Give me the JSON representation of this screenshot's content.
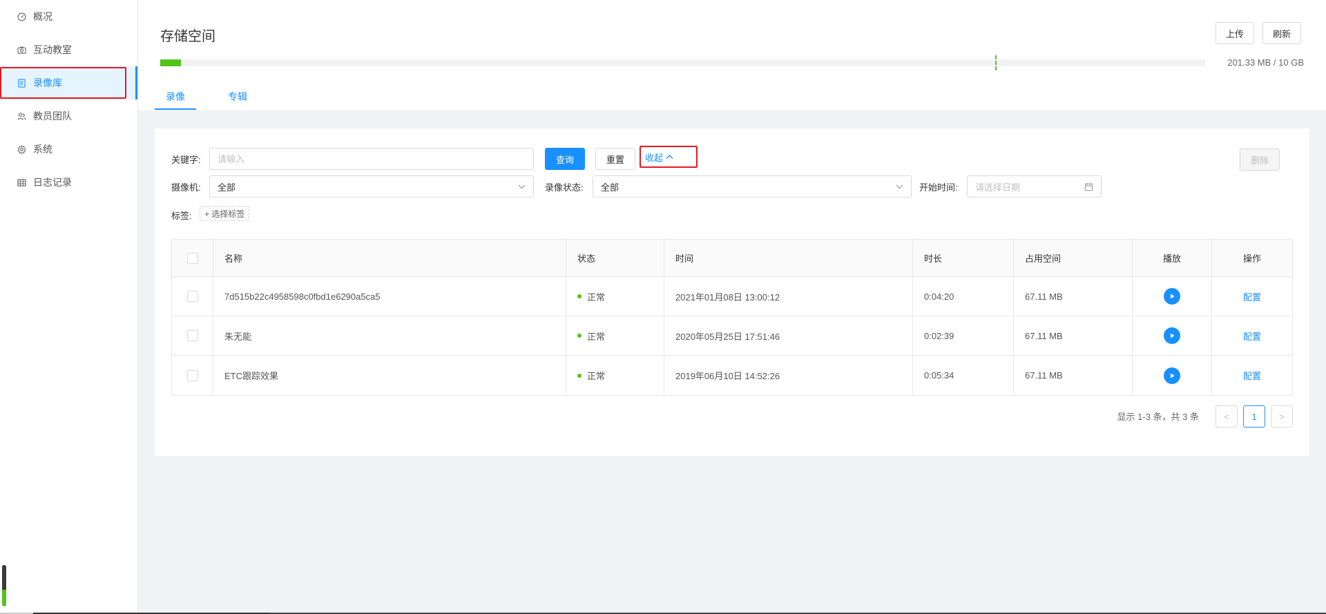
{
  "sidebar": {
    "items": [
      {
        "label": "概况",
        "icon": "dashboard-icon"
      },
      {
        "label": "互动教室",
        "icon": "camera-icon"
      },
      {
        "label": "录像库",
        "icon": "video-library-icon"
      },
      {
        "label": "教员团队",
        "icon": "team-icon"
      },
      {
        "label": "系统",
        "icon": "gear-icon"
      },
      {
        "label": "日志记录",
        "icon": "table-icon"
      }
    ],
    "active_index": 2
  },
  "header": {
    "title": "存储空间",
    "upload_label": "上传",
    "refresh_label": "刷新",
    "usage_text": "201.33 MB / 10 GB",
    "usage_fill_fraction": 0.0197,
    "tabs": [
      {
        "label": "录像"
      },
      {
        "label": "专辑"
      }
    ]
  },
  "filters": {
    "keyword_label": "关键字:",
    "keyword_placeholder": "请输入",
    "query_label": "查询",
    "reset_label": "重置",
    "collapse_label": "收起",
    "delete_label": "删除",
    "camera_label": "摄像机:",
    "camera_value": "全部",
    "status_label": "录像状态:",
    "status_value": "全部",
    "start_time_label": "开始时间:",
    "start_time_placeholder": "请选择日期",
    "tags_label": "标签:",
    "tags_add_label": "+ 选择标签"
  },
  "table": {
    "headers": {
      "name": "名称",
      "status": "状态",
      "time": "时间",
      "duration": "时长",
      "size": "占用空间",
      "play": "播放",
      "action": "操作"
    },
    "rows": [
      {
        "name": "7d515b22c4958598c0fbd1e6290a5ca5",
        "status": "正常",
        "time": "2021年01月08日 13:00:12",
        "duration": "0:04:20",
        "size": "67.11 MB",
        "action": "配置"
      },
      {
        "name": "朱无能",
        "status": "正常",
        "time": "2020年05月25日 17:51:46",
        "duration": "0:02:39",
        "size": "67.11 MB",
        "action": "配置"
      },
      {
        "name": "ETC跟踪效果",
        "status": "正常",
        "time": "2019年06月10日 14:52:26",
        "duration": "0:05:34",
        "size": "67.11 MB",
        "action": "配置"
      }
    ]
  },
  "pagination": {
    "info": "显示 1-3 条，共 3 条",
    "prev": "<",
    "current": "1",
    "next": ">"
  },
  "colors": {
    "accent": "#1890ff",
    "success": "#52c41a",
    "highlight_border": "#e5191e"
  }
}
